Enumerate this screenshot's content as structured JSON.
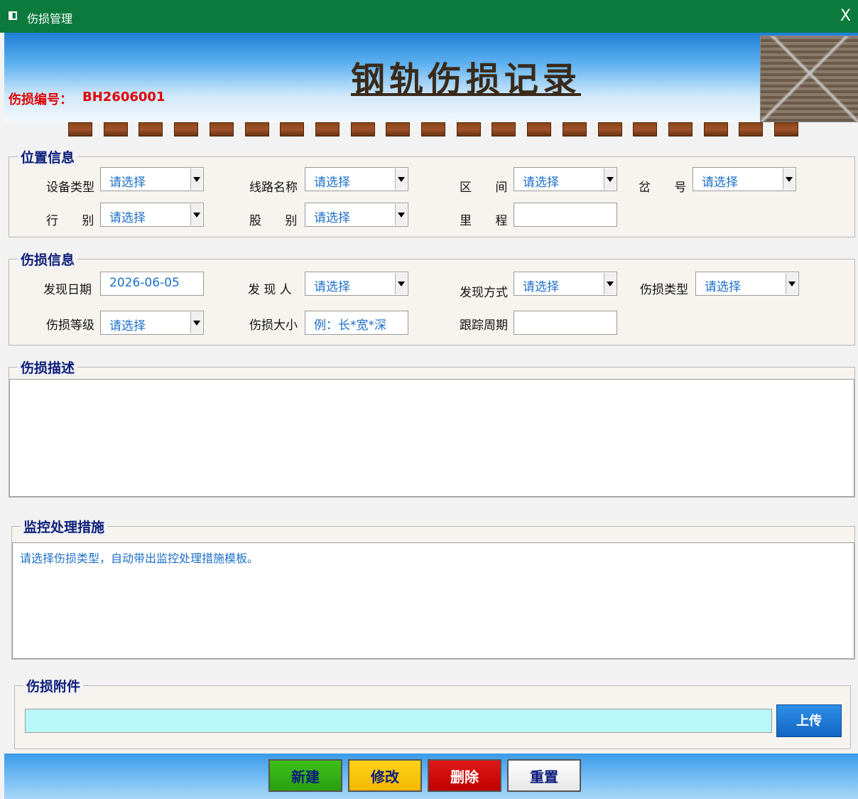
{
  "window": {
    "title": "伤损管理",
    "close_glyph": "X"
  },
  "header": {
    "title": "钢轨伤损记录",
    "number_label": "伤损编号：",
    "number_value": "BH2606001"
  },
  "sections": {
    "position": {
      "legend": "位置信息",
      "device_type_label": "设备类型",
      "device_type_value": "请选择",
      "line_name_label": "线路名称",
      "line_name_value": "请选择",
      "section_label": "区 间",
      "section_value": "请选择",
      "switch_no_label": "岔 号",
      "switch_no_value": "请选择",
      "track_side_label": "行 别",
      "track_side_value": "请选择",
      "track_no_label": "股 别",
      "track_no_value": "请选择",
      "mileage_label": "里 程",
      "mileage_value": ""
    },
    "damage": {
      "legend": "伤损信息",
      "date_label": "发现日期",
      "date_value": "2026-06-05",
      "finder_label": "发 现 人",
      "finder_value": "请选择",
      "method_label": "发现方式",
      "method_value": "请选择",
      "type_label": "伤损类型",
      "type_value": "请选择",
      "level_label": "伤损等级",
      "level_value": "请选择",
      "size_label": "伤损大小",
      "size_placeholder": "例：长*宽*深",
      "cycle_label": "跟踪周期",
      "cycle_value": ""
    },
    "description": {
      "legend": "伤损描述",
      "value": ""
    },
    "measures": {
      "legend": "监控处理措施",
      "value": "请选择伤损类型，自动带出监控处理措施模板。"
    },
    "attachment": {
      "legend": "伤损附件",
      "value": "",
      "upload_label": "上传"
    }
  },
  "buttons": {
    "new": "新建",
    "edit": "修改",
    "delete": "删除",
    "reset": "重置"
  },
  "colors": {
    "titlebar": "#0b7a3c",
    "legend": "#0b1c7a",
    "value_text": "#1d6fc9",
    "number_text": "#e00000"
  }
}
